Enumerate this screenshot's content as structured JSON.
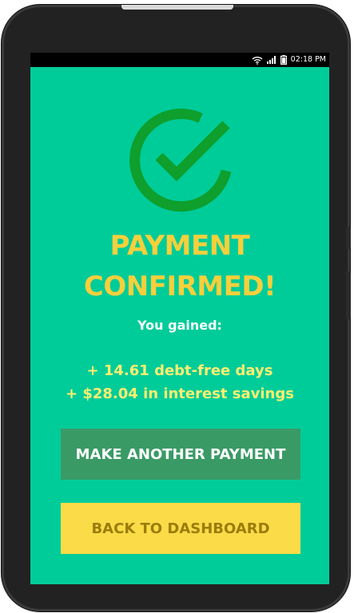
{
  "status_bar": {
    "time": "02:18 PM",
    "icons": [
      "wifi-icon",
      "signal-icon",
      "battery-icon"
    ]
  },
  "confirmation": {
    "icon": "check-circle-icon",
    "title_line1": "PAYMENT",
    "title_line2": "CONFIRMED!",
    "gained_label": "You gained:",
    "benefit_days": "+ 14.61 debt-free days",
    "benefit_savings": "+ $28.04 in interest savings"
  },
  "actions": {
    "make_another_label": "MAKE ANOTHER PAYMENT",
    "back_dashboard_label": "BACK TO DASHBOARD"
  },
  "colors": {
    "screen_bg": "#00cc99",
    "check_green": "#0e9f2c",
    "title_yellow": "#f7cf3c",
    "benefit_yellow": "#ffee70",
    "secondary_button": "#3a9a66",
    "primary_button": "#fbdb47",
    "primary_button_text": "#9a7d0a"
  }
}
